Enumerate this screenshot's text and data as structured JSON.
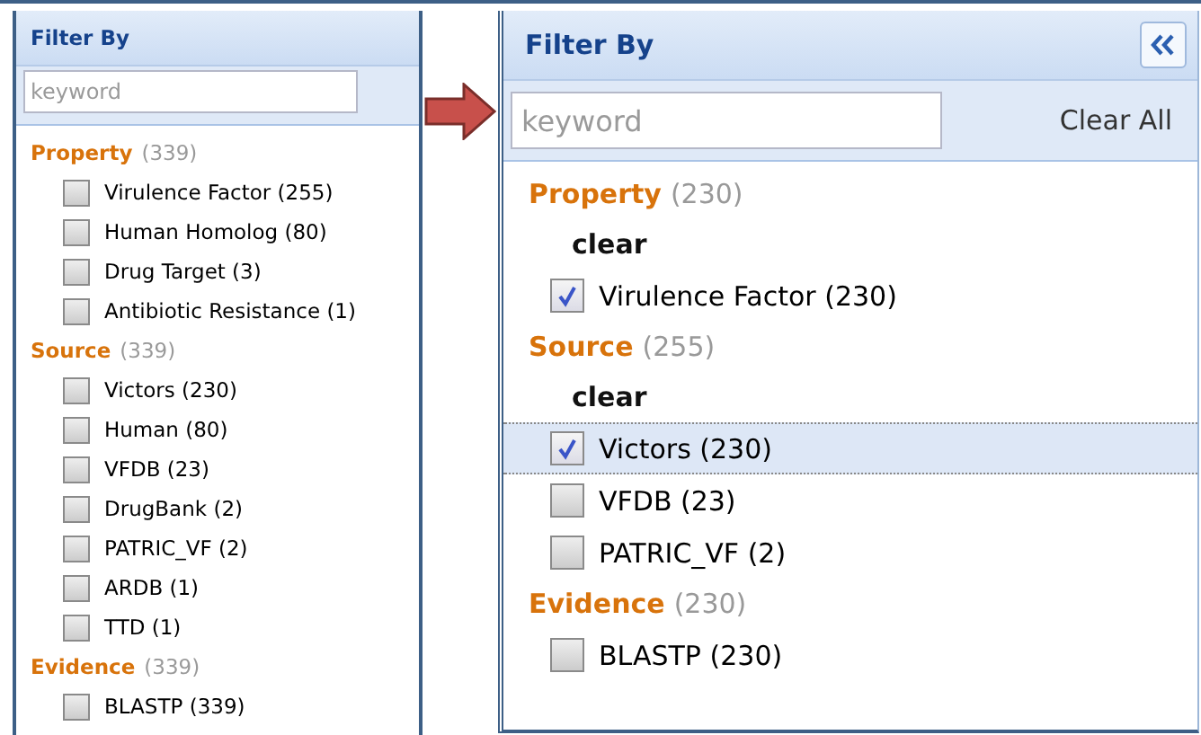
{
  "panels": [
    {
      "title": "Filter By",
      "search": {
        "placeholder": "keyword"
      },
      "collapse_button": false,
      "groups": [
        {
          "name": "Property",
          "count": "(339)",
          "options": [
            {
              "label": "Virulence Factor (255)",
              "checked": false,
              "selected": false
            },
            {
              "label": "Human Homolog (80)",
              "checked": false,
              "selected": false
            },
            {
              "label": "Drug Target (3)",
              "checked": false,
              "selected": false
            },
            {
              "label": "Antibiotic Resistance (1)",
              "checked": false,
              "selected": false
            }
          ]
        },
        {
          "name": "Source",
          "count": "(339)",
          "options": [
            {
              "label": "Victors (230)",
              "checked": false,
              "selected": false
            },
            {
              "label": "Human (80)",
              "checked": false,
              "selected": false
            },
            {
              "label": "VFDB (23)",
              "checked": false,
              "selected": false
            },
            {
              "label": "DrugBank (2)",
              "checked": false,
              "selected": false
            },
            {
              "label": "PATRIC_VF (2)",
              "checked": false,
              "selected": false
            },
            {
              "label": "ARDB (1)",
              "checked": false,
              "selected": false
            },
            {
              "label": "TTD (1)",
              "checked": false,
              "selected": false
            }
          ]
        },
        {
          "name": "Evidence",
          "count": "(339)",
          "options": [
            {
              "label": "BLASTP (339)",
              "checked": false,
              "selected": false
            }
          ]
        }
      ]
    },
    {
      "title": "Filter By",
      "search": {
        "placeholder": "keyword"
      },
      "clear_all": "Clear All",
      "collapse_button": true,
      "groups": [
        {
          "name": "Property",
          "count": "(230)",
          "clear": "clear",
          "options": [
            {
              "label": "Virulence Factor (230)",
              "checked": true,
              "selected": false
            }
          ]
        },
        {
          "name": "Source",
          "count": "(255)",
          "clear": "clear",
          "options": [
            {
              "label": "Victors (230)",
              "checked": true,
              "selected": true
            },
            {
              "label": "VFDB (23)",
              "checked": false,
              "selected": false
            },
            {
              "label": "PATRIC_VF (2)",
              "checked": false,
              "selected": false
            }
          ]
        },
        {
          "name": "Evidence",
          "count": "(230)",
          "options": [
            {
              "label": "BLASTP (230)",
              "checked": false,
              "selected": false
            }
          ]
        }
      ]
    }
  ]
}
